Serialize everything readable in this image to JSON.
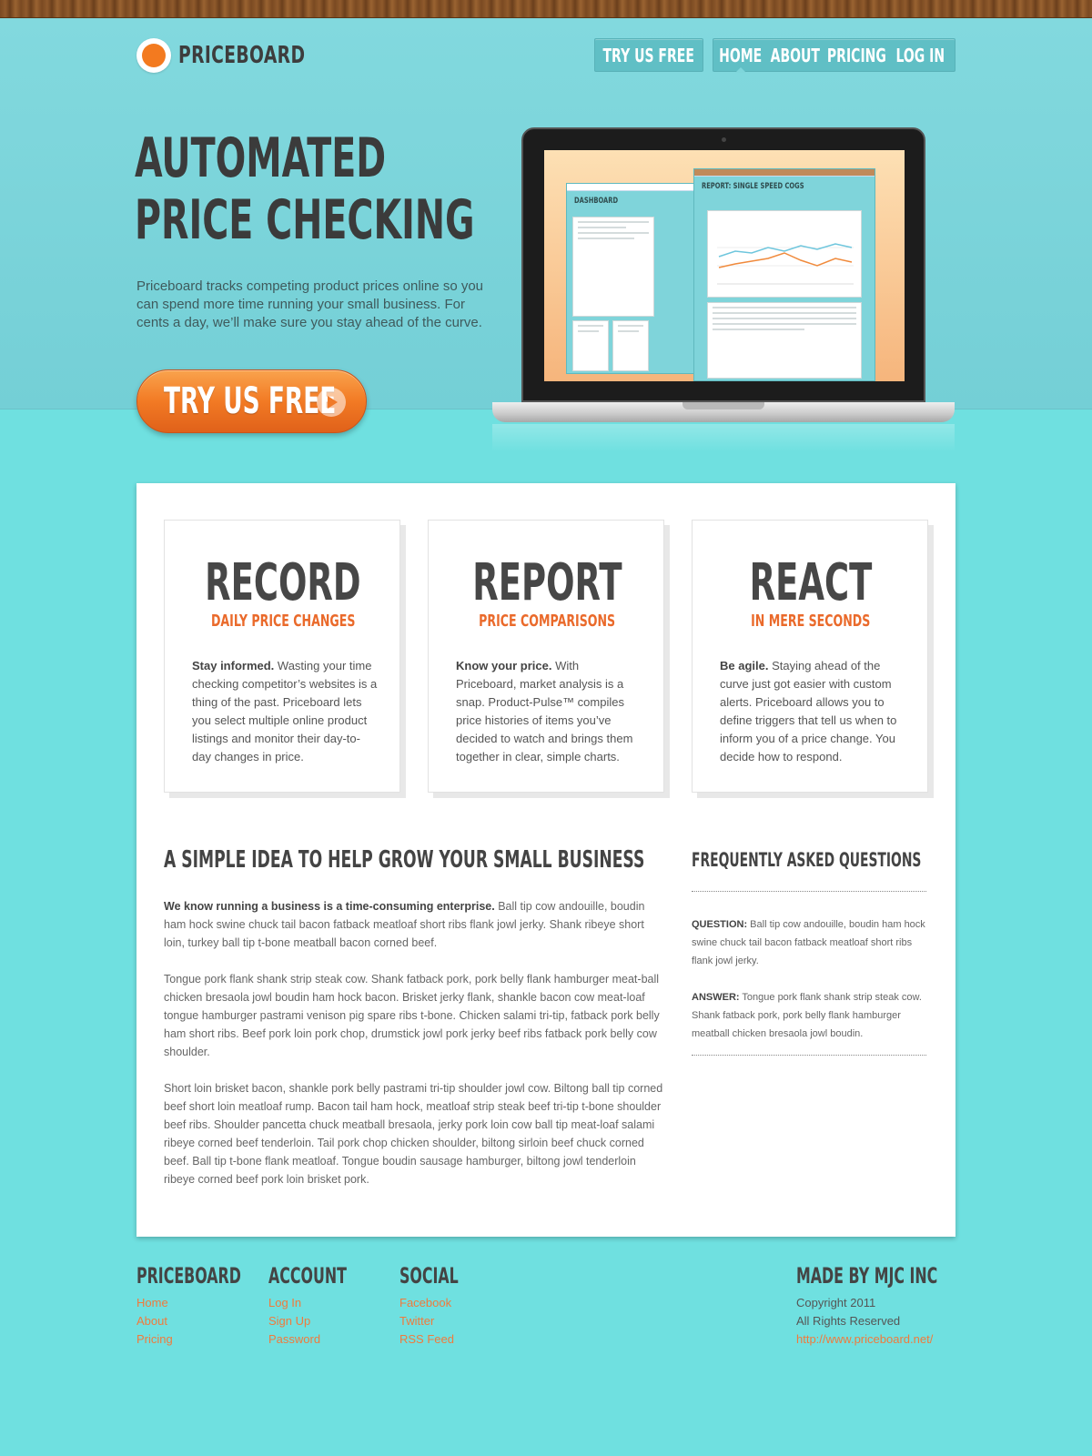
{
  "brand": {
    "name": "PRICEBOARD"
  },
  "header": {
    "try_label": "TRY US FREE",
    "nav": [
      "HOME",
      "ABOUT",
      "PRICING",
      "LOG IN"
    ]
  },
  "hero": {
    "title_line1": "AUTOMATED",
    "title_line2": "PRICE CHECKING",
    "description": "Priceboard tracks competing product prices online so you can spend more time running your small business. For cents a day, we’ll make sure you stay ahead of the curve.",
    "cta_label": "TRY US FREE"
  },
  "laptop": {
    "app_left_title": "DASHBOARD",
    "app_right_title": "REPORT: SINGLE SPEED COGS"
  },
  "features": [
    {
      "title": "RECORD",
      "subtitle": "DAILY PRICE CHANGES",
      "lead": "Stay informed.",
      "body": " Wasting your time checking competitor’s websites is a thing of the past.  Priceboard lets you select multiple online product listings and monitor their day-to-day changes in price."
    },
    {
      "title": "REPORT",
      "subtitle": "PRICE COMPARISONS",
      "lead": "Know your price.",
      "body": " With Priceboard, market analysis is a snap. Product-Pulse™ compiles price histories of items you’ve decided to watch and brings them together in clear, simple charts."
    },
    {
      "title": "REACT",
      "subtitle": "IN MERE SECONDS",
      "lead": "Be agile.",
      "body": " Staying ahead of the curve just got easier with custom alerts. Priceboard allows you to define triggers that tell us when to inform you of a price change. You decide how to respond."
    }
  ],
  "about": {
    "title": "A SIMPLE IDEA TO HELP GROW YOUR SMALL BUSINESS",
    "p1_lead": "We know running a business is a time-consuming enterprise.",
    "p1_body": " Ball tip cow andouille, boudin ham hock swine chuck tail bacon fatback meatloaf short ribs flank jowl jerky. Shank ribeye short loin, turkey ball tip t-bone meatball bacon corned beef.",
    "p2": "Tongue pork flank shank strip steak cow. Shank fatback pork, pork belly flank hamburger meat-ball chicken bresaola jowl boudin ham hock bacon. Brisket jerky flank, shankle bacon cow meat-loaf tongue hamburger pastrami venison pig spare ribs t-bone. Chicken salami tri-tip, fatback pork belly ham short ribs. Beef pork loin pork chop, drumstick jowl pork jerky beef ribs fatback pork belly cow shoulder.",
    "p3": "Short loin brisket bacon, shankle pork belly pastrami tri-tip shoulder jowl cow. Biltong ball tip corned beef short loin meatloaf rump. Bacon tail ham hock, meatloaf strip steak beef tri-tip t-bone shoulder beef ribs. Shoulder pancetta chuck meatball bresaola, jerky pork loin cow ball tip meat-loaf salami ribeye corned beef tenderloin. Tail pork chop chicken shoulder, biltong sirloin beef chuck corned beef. Ball tip t-bone flank meatloaf. Tongue boudin sausage hamburger, biltong jowl tenderloin ribeye corned beef pork loin brisket pork."
  },
  "faq": {
    "title": "FREQUENTLY ASKED QUESTIONS",
    "q_label": "QUESTION:",
    "q_text": " Ball tip cow andouille, boudin ham hock swine chuck tail bacon fatback meatloaf short ribs flank jowl jerky.",
    "a_label": "ANSWER:",
    "a_text": " Tongue pork flank shank strip steak cow. Shank fatback pork, pork belly flank hamburger meatball chicken bresaola jowl boudin."
  },
  "footer": {
    "col1": {
      "heading": "PRICEBOARD",
      "links": [
        "Home",
        "About",
        "Pricing"
      ]
    },
    "col2": {
      "heading": "ACCOUNT",
      "links": [
        "Log In",
        "Sign Up",
        "Password"
      ]
    },
    "col3": {
      "heading": "SOCIAL",
      "links": [
        "Facebook",
        "Twitter",
        "RSS Feed"
      ]
    },
    "col4": {
      "heading": "MADE BY MJC INC",
      "copyright": "Copyright 2011",
      "rights": "All Rights Reserved",
      "url": "http://www.priceboard.net/"
    }
  },
  "colors": {
    "accent": "#f07a24",
    "teal": "#6fe0e0",
    "heading": "#444444"
  }
}
